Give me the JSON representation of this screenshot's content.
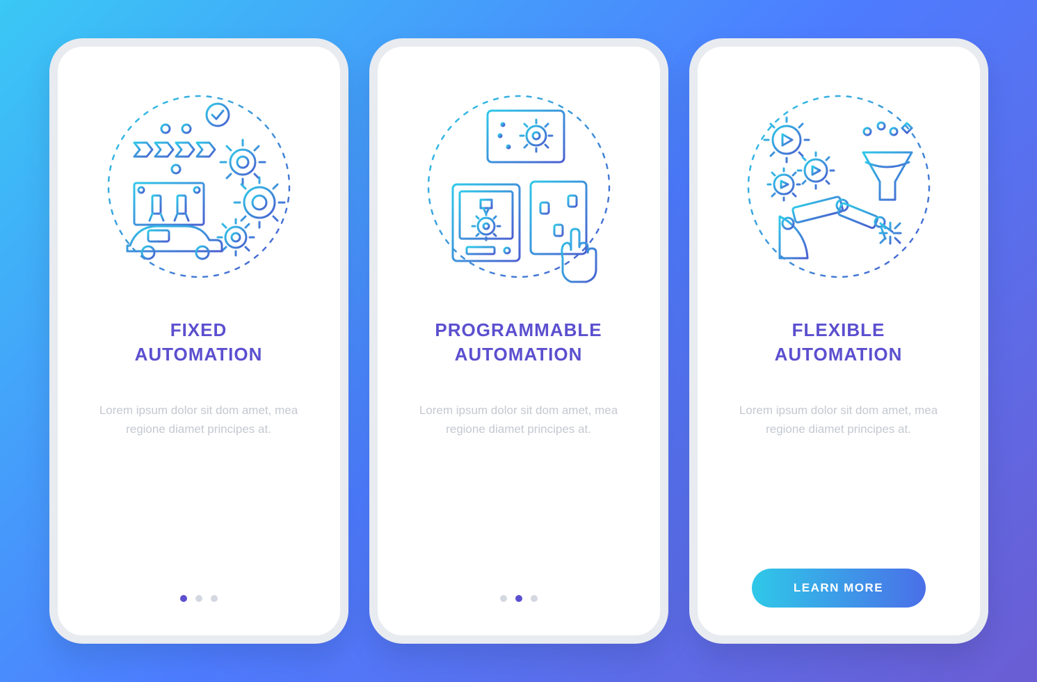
{
  "screens": [
    {
      "title": "FIXED\nAUTOMATION",
      "body": "Lorem ipsum dolor sit dom amet, mea regione diamet principes at.",
      "active_dot": 0,
      "icon": "fixed-automation-icon"
    },
    {
      "title": "PROGRAMMABLE\nAUTOMATION",
      "body": "Lorem ipsum dolor sit dom amet, mea regione diamet principes at.",
      "active_dot": 1,
      "icon": "programmable-automation-icon"
    },
    {
      "title": "FLEXIBLE\nAUTOMATION",
      "body": "Lorem ipsum dolor sit dom amet, mea regione diamet principes at.",
      "icon": "flexible-automation-icon",
      "cta_label": "LEARN MORE"
    }
  ],
  "colors": {
    "gradient_start": "#3AC8F5",
    "gradient_end": "#6B5DD3",
    "heading": "#5B4FCF",
    "body": "#C4C8D0",
    "stroke_light": "#2FC8E8",
    "stroke_dark": "#4A5FD0"
  }
}
